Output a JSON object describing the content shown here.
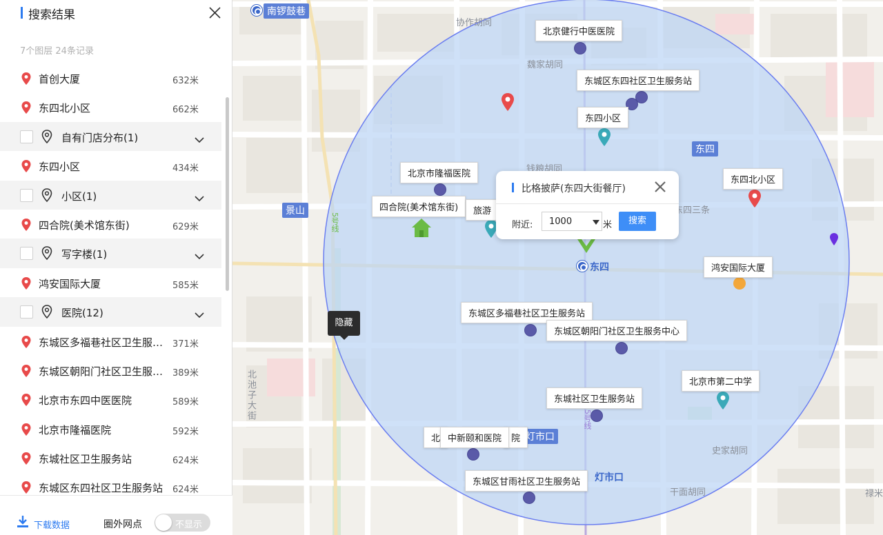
{
  "sidebar": {
    "title": "搜索结果",
    "summary": "7个图层 24条记录",
    "rows": [
      {
        "kind": "item",
        "name": "首创大厦",
        "dist": "632米"
      },
      {
        "kind": "item",
        "name": "东四北小区",
        "dist": "662米"
      },
      {
        "kind": "group",
        "name": "自有门店分布(1)"
      },
      {
        "kind": "item",
        "name": "东四小区",
        "dist": "434米"
      },
      {
        "kind": "group",
        "name": "小区(1)"
      },
      {
        "kind": "item",
        "name": "四合院(美术馆东街)",
        "dist": "629米"
      },
      {
        "kind": "group",
        "name": "写字楼(1)"
      },
      {
        "kind": "item",
        "name": "鸿安国际大厦",
        "dist": "585米"
      },
      {
        "kind": "group",
        "name": "医院(12)"
      },
      {
        "kind": "item",
        "name": "东城区多福巷社区卫生服务站",
        "dist": "371米"
      },
      {
        "kind": "item",
        "name": "东城区朝阳门社区卫生服务中心",
        "dist": "389米"
      },
      {
        "kind": "item",
        "name": "北京市东四中医医院",
        "dist": "589米"
      },
      {
        "kind": "item",
        "name": "北京市隆福医院",
        "dist": "592米"
      },
      {
        "kind": "item",
        "name": "东城社区卫生服务站",
        "dist": "624米"
      },
      {
        "kind": "item",
        "name": "东城区东四社区卫生服务站",
        "dist": "624米"
      }
    ],
    "footer": {
      "download": "下载数据",
      "outside": "圈外网点",
      "toggle": "不显示"
    }
  },
  "map": {
    "hide_tip": "隐藏",
    "streets": [
      "协作胡同",
      "魏家胡同",
      "钱粮胡同",
      "东四三条",
      "史家胡同",
      "干面胡同",
      "禄米",
      "北池子大街"
    ],
    "metro": [
      "南锣鼓巷",
      "东四",
      "灯市口",
      "景山",
      "东四",
      "灯市口"
    ],
    "line_marks": [
      "5号线",
      "5号线"
    ],
    "labels": [
      "北京健行中医医院",
      "东城区东四社区卫生服务站",
      "东四小区",
      "北京市隆福医院",
      "东四北小区",
      "四合院(美术馆东街)",
      "旅游",
      "鸿安国际大厦",
      "东城区多福巷社区卫生服务站",
      "东城区朝阳门社区卫生服务中心",
      "北京市第二中学",
      "东城社区卫生服务站",
      "北",
      "院",
      "中新颐和医院",
      "东城区甘雨社区卫生服务站"
    ],
    "popup": {
      "title": "比格披萨(东四大街餐厅)",
      "near_label": "附近:",
      "radius": "1000",
      "unit": "米",
      "search": "搜索"
    },
    "colors": {
      "circle_fill": "#bcd5f5",
      "circle_stroke": "#6b7ef0",
      "hospital_dot": "#5a5aa8",
      "red_pin": "#e84a4a",
      "teal_pin": "#3aa9b8",
      "green_marker": "#6bbb45",
      "accent": "#2d7bf0"
    }
  }
}
